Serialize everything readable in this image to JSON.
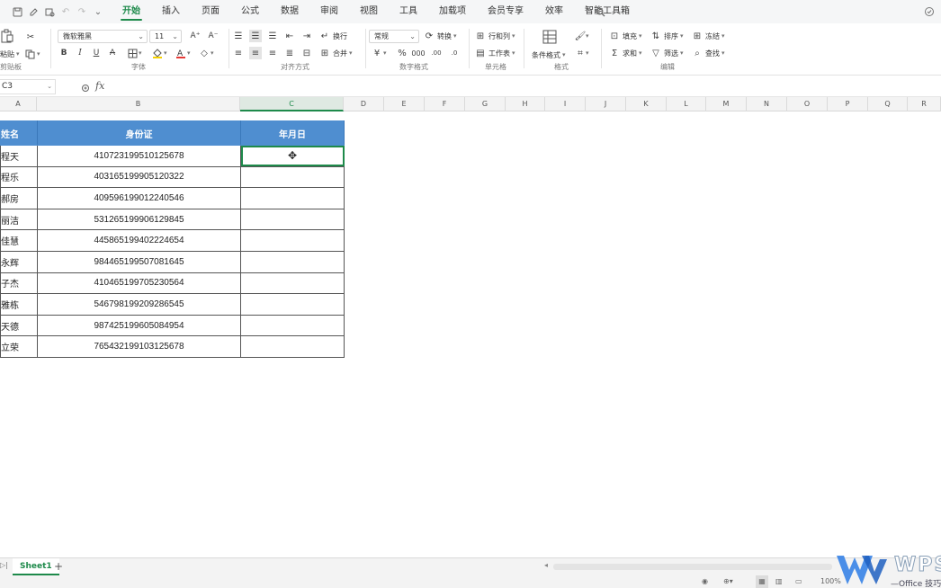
{
  "quick_access": {
    "icons": [
      "save-icon",
      "edit-icon",
      "print-preview-icon",
      "undo-icon",
      "redo-icon",
      "more-icon"
    ]
  },
  "menu": {
    "tabs": [
      "开始",
      "插入",
      "页面",
      "公式",
      "数据",
      "审阅",
      "视图",
      "工具",
      "加载项",
      "会员专享",
      "效率",
      "智能工具箱"
    ],
    "active_tab": "开始",
    "active_color": "#1e8a4b"
  },
  "ribbon": {
    "clipboard": {
      "paste_label": "粘贴",
      "group_label": "剪贴板"
    },
    "font": {
      "font_name": "微软雅黑",
      "font_size": "11",
      "group_label": "字体"
    },
    "alignment": {
      "wrap_label": "换行",
      "merge_label": "合并",
      "group_label": "对齐方式"
    },
    "number": {
      "format_value": "常规",
      "convert_label": "转换",
      "group_label": "数字格式"
    },
    "cells": {
      "rowcol_label": "行和列",
      "sheet_label": "工作表",
      "group_label": "单元格"
    },
    "styles": {
      "cond_format_label": "条件格式",
      "group_label": "格式"
    },
    "editing": {
      "fill_label": "填充",
      "sort_label": "排序",
      "freeze_label": "冻结",
      "sum_label": "求和",
      "filter_label": "筛选",
      "find_label": "查找",
      "group_label": "编辑"
    }
  },
  "formula_bar": {
    "name_box": "C3",
    "fx_label": "fx",
    "formula_value": ""
  },
  "columns": [
    "A",
    "B",
    "C",
    "D",
    "E",
    "F",
    "G",
    "H",
    "I",
    "J",
    "K",
    "L",
    "M",
    "N",
    "O",
    "P",
    "Q",
    "R"
  ],
  "selected_column": "C",
  "table": {
    "header_color": "#4f8ed0",
    "headers": [
      "姓名",
      "身份证",
      "年月日"
    ],
    "rows": [
      {
        "name": "程天",
        "id": "410723199510125678",
        "date": ""
      },
      {
        "name": "程乐",
        "id": "403165199905120322",
        "date": ""
      },
      {
        "name": "郝房",
        "id": "409596199012240546",
        "date": ""
      },
      {
        "name": "丽洁",
        "id": "531265199906129845",
        "date": ""
      },
      {
        "name": "佳慧",
        "id": "445865199402224654",
        "date": ""
      },
      {
        "name": "永辉",
        "id": "984465199507081645",
        "date": ""
      },
      {
        "name": "子杰",
        "id": "410465199705230564",
        "date": ""
      },
      {
        "name": "雅栋",
        "id": "546798199209286545",
        "date": ""
      },
      {
        "name": "天德",
        "id": "987425199605084954",
        "date": ""
      },
      {
        "name": "立荣",
        "id": "765432199103125678",
        "date": ""
      }
    ]
  },
  "sheets": {
    "active": "Sheet1",
    "add_label": "+"
  },
  "status": {
    "zoom": "100%"
  },
  "watermark": {
    "brand": "WPS",
    "subtitle": "—Office 技巧"
  }
}
